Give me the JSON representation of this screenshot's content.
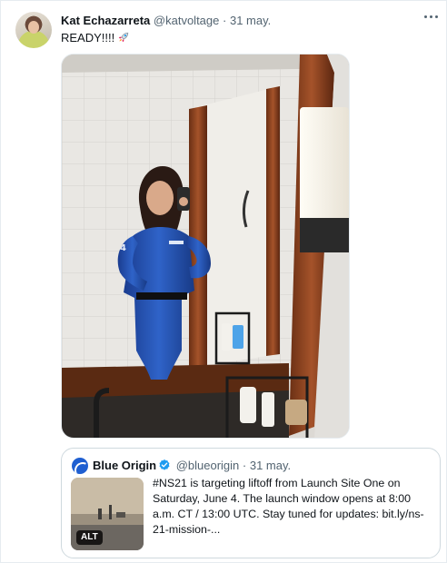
{
  "author": {
    "name": "Kat Echazarreta",
    "handle": "@katvoltage",
    "separator": "·",
    "date": "31 may."
  },
  "tweet": {
    "text": "READY!!!!",
    "emoji_icon": "rocket-icon"
  },
  "media": {
    "description_icon": "photo-image"
  },
  "quoted_tweet": {
    "name": "Blue Origin",
    "verified_icon": "verified-badge-icon",
    "handle": "@blueorigin",
    "separator": "·",
    "date": "31 may.",
    "alt_badge": "ALT",
    "text": "#NS21 is targeting liftoff from Launch Site One on Saturday, June 4. The launch window opens at 8:00 a.m. CT / 13:00 UTC. Stay tuned for updates: bit.ly/ns-21-mission-..."
  },
  "colors": {
    "text": "#0f1419",
    "secondary": "#536471",
    "verified": "#1d9bf0",
    "border": "#cfd9de"
  }
}
